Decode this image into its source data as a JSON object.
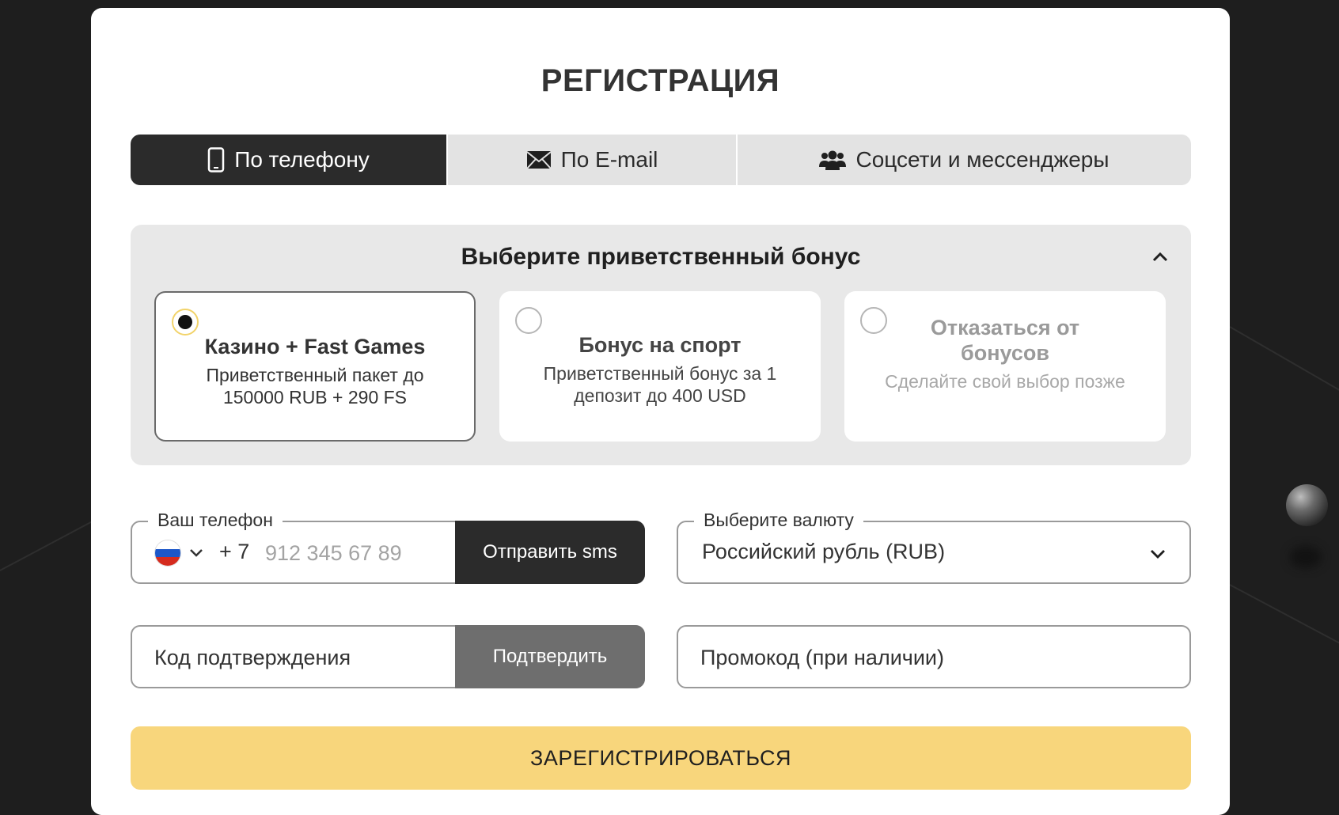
{
  "title": "РЕГИСТРАЦИЯ",
  "tabs": [
    {
      "label": "По телефону",
      "icon": "smartphone-icon",
      "active": true
    },
    {
      "label": "По E-mail",
      "icon": "envelope-icon",
      "active": false
    },
    {
      "label": "Соцсети и мессенджеры",
      "icon": "users-icon",
      "active": false
    }
  ],
  "bonus": {
    "title": "Выберите приветственный бонус",
    "options": [
      {
        "title": "Казино + Fast Games",
        "desc": "Приветственный пакет до 150000 RUB + 290 FS",
        "selected": true
      },
      {
        "title": "Бонус на спорт",
        "desc": "Приветственный бонус за 1 депозит до 400 USD",
        "selected": false
      },
      {
        "title": "Отказаться от бонусов",
        "desc": "Сделайте свой выбор позже",
        "selected": false
      }
    ]
  },
  "phone": {
    "label": "Ваш телефон",
    "prefix": "+ 7",
    "placeholder": "912 345 67 89",
    "country": "RU",
    "send_sms_label": "Отправить sms"
  },
  "currency": {
    "label": "Выберите валюту",
    "value": "Российский рубль (RUB)"
  },
  "code": {
    "placeholder": "Код подтверждения",
    "confirm_label": "Подтвердить"
  },
  "promo": {
    "placeholder": "Промокод (при наличии)"
  },
  "register_label": "ЗАРЕГИСТРИРОВАТЬСЯ",
  "colors": {
    "accent": "#f8d67c",
    "dark": "#2b2b2b",
    "panel": "#e8e8e8"
  }
}
